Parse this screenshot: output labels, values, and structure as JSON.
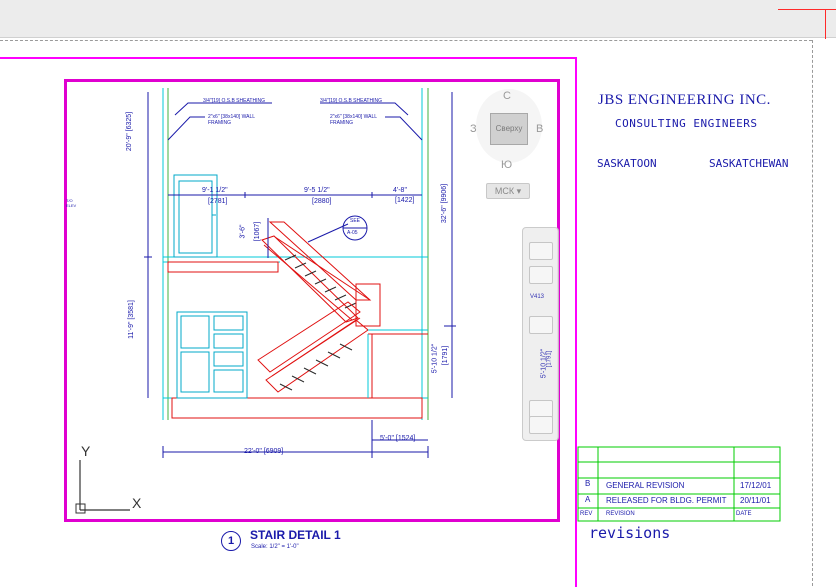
{
  "titleblock": {
    "company": "JBS ENGINEERING INC.",
    "subtitle": "CONSULTING ENGINEERS",
    "city": "SASKATOON",
    "province": "SASKATCHEWAN",
    "revisions_label": "revisions"
  },
  "revisions": {
    "rows": [
      {
        "rev": "B",
        "desc": "GENERAL REVISION",
        "date": "17/12/01"
      },
      {
        "rev": "A",
        "desc": "RELEASED FOR BLDG. PERMIT",
        "date": "20/11/01"
      }
    ],
    "header": {
      "rev": "REV",
      "desc": "REVISION",
      "date": "DATE"
    }
  },
  "detail_title": {
    "number": "1",
    "name": "STAIR DETAIL 1",
    "scale": "Scale: 1/2\" = 1'-0\""
  },
  "viewcube": {
    "north": "С",
    "south": "Ю",
    "west": "З",
    "east": "В",
    "face": "Сверху",
    "wcs": "МСК"
  },
  "ucs": {
    "x_label": "X",
    "y_label": "Y"
  },
  "drawing_text": {
    "sheathing_left": "3/4\"[19] O.S.B SHEATHING",
    "sheathing_right": "3/4\"[19] O.S.B SHEATHING",
    "framing_left": "2\"x6\" [38x140] WALL FRAMING",
    "framing_right": "2\"x6\" [38x140] WALL FRAMING",
    "dim_top_left": "9'-1 1/2\"",
    "dim_top_left_mm": "[2781]",
    "dim_top_mid": "9'-5 1/2\"",
    "dim_top_mid_mm": "[2880]",
    "dim_top_right": "4'-8\"",
    "dim_top_right_mm": "[1422]",
    "dim_vert_top": "20'-9\" [6325]",
    "dim_vert_mid": "11'-9\" [3581]",
    "dim_vert_right": "32'-6\" [9906]",
    "dim_landing": "3'-6\"",
    "dim_landing_mm": "[1067]",
    "dim_right_lower": "5'-10 1/2\"",
    "dim_right_lower_mm": "[1791]",
    "dim_nav_vert": "5'-10 1/2\"",
    "dim_nav_vert_mm": "[1791]",
    "dim_bottom": "22'-0\" [6909]",
    "dim_bottom_right": "5'-0\" [1524]",
    "callout_top": "SEE",
    "callout_bottom": "A-05",
    "elev_label": "T/O ELEV",
    "nav_label": "V413"
  },
  "colors": {
    "sheet_border": "#ff00ff",
    "drawing_blue": "#1a1aaa",
    "stair_red": "#e01010",
    "cyan": "#00c8d8",
    "rev_table_green": "#00cc00"
  }
}
